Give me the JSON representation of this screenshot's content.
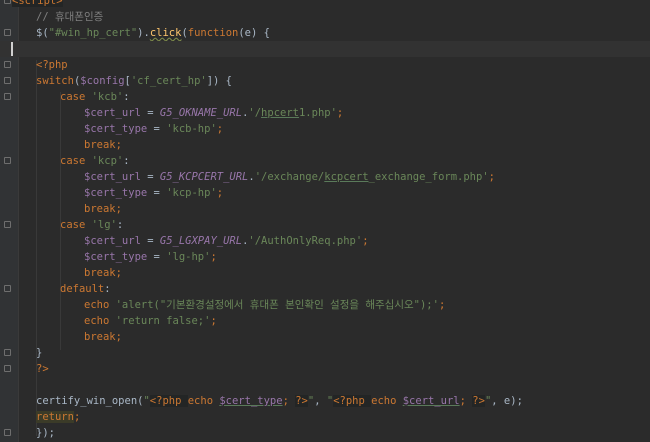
{
  "editor": {
    "theme": {
      "background": "#2b2b2b",
      "keyword": "#cc7832",
      "string": "#6a8759",
      "comment": "#808080",
      "function": "#ffc66d",
      "variable": "#9876aa",
      "text": "#a9b7c6"
    },
    "lines": [
      {
        "indent": 0,
        "tokens": [
          {
            "t": "<script>",
            "c": "tag"
          }
        ],
        "fold": true
      },
      {
        "indent": 1,
        "tokens": [
          {
            "t": "// 휴대폰인증",
            "c": "c"
          }
        ]
      },
      {
        "indent": 1,
        "tokens": [
          {
            "t": "$(",
            "c": "p"
          },
          {
            "t": "\"#win_hp_cert\"",
            "c": "s"
          },
          {
            "t": ").",
            "c": "p"
          },
          {
            "t": "click",
            "c": "f w"
          },
          {
            "t": "(",
            "c": "p"
          },
          {
            "t": "function",
            "c": "k"
          },
          {
            "t": "(e) {",
            "c": "p"
          }
        ],
        "fold": true
      },
      {
        "indent": 0,
        "tokens": [],
        "highlight": true,
        "caret": true
      },
      {
        "indent": 1,
        "tokens": [
          {
            "t": "<?php",
            "c": "k"
          }
        ],
        "fold": true
      },
      {
        "indent": 1,
        "tokens": [
          {
            "t": "switch",
            "c": "k"
          },
          {
            "t": "(",
            "c": "p"
          },
          {
            "t": "$config",
            "c": "v"
          },
          {
            "t": "[",
            "c": "p"
          },
          {
            "t": "'cf_cert_hp'",
            "c": "s"
          },
          {
            "t": "]) {",
            "c": "p"
          }
        ],
        "fold": true
      },
      {
        "indent": 2,
        "tokens": [
          {
            "t": "case ",
            "c": "k"
          },
          {
            "t": "'kcb'",
            "c": "s"
          },
          {
            "t": ":",
            "c": "p"
          }
        ],
        "fold": true
      },
      {
        "indent": 3,
        "tokens": [
          {
            "t": "$cert_url",
            "c": "v"
          },
          {
            "t": " = ",
            "c": "p"
          },
          {
            "t": "G5_OKNAME_URL",
            "c": "kc"
          },
          {
            "t": ".",
            "c": "p"
          },
          {
            "t": "'/",
            "c": "s"
          },
          {
            "t": "hpcert",
            "c": "s u"
          },
          {
            "t": "1.php'",
            "c": "s"
          },
          {
            "t": ";",
            "c": "k"
          }
        ]
      },
      {
        "indent": 3,
        "tokens": [
          {
            "t": "$cert_type",
            "c": "v"
          },
          {
            "t": " = ",
            "c": "p"
          },
          {
            "t": "'kcb-hp'",
            "c": "s"
          },
          {
            "t": ";",
            "c": "k"
          }
        ]
      },
      {
        "indent": 3,
        "tokens": [
          {
            "t": "break",
            "c": "k"
          },
          {
            "t": ";",
            "c": "k"
          }
        ]
      },
      {
        "indent": 2,
        "tokens": [
          {
            "t": "case ",
            "c": "k"
          },
          {
            "t": "'kcp'",
            "c": "s"
          },
          {
            "t": ":",
            "c": "p"
          }
        ],
        "fold": true
      },
      {
        "indent": 3,
        "tokens": [
          {
            "t": "$cert_url",
            "c": "v"
          },
          {
            "t": " = ",
            "c": "p"
          },
          {
            "t": "G5_KCPCERT_URL",
            "c": "kc"
          },
          {
            "t": ".",
            "c": "p"
          },
          {
            "t": "'/exchange/",
            "c": "s"
          },
          {
            "t": "kcpcert",
            "c": "s u"
          },
          {
            "t": "_exchange_form.php'",
            "c": "s"
          },
          {
            "t": ";",
            "c": "k"
          }
        ]
      },
      {
        "indent": 3,
        "tokens": [
          {
            "t": "$cert_type",
            "c": "v"
          },
          {
            "t": " = ",
            "c": "p"
          },
          {
            "t": "'kcp-hp'",
            "c": "s"
          },
          {
            "t": ";",
            "c": "k"
          }
        ]
      },
      {
        "indent": 3,
        "tokens": [
          {
            "t": "break",
            "c": "k"
          },
          {
            "t": ";",
            "c": "k"
          }
        ]
      },
      {
        "indent": 2,
        "tokens": [
          {
            "t": "case ",
            "c": "k"
          },
          {
            "t": "'lg'",
            "c": "s"
          },
          {
            "t": ":",
            "c": "p"
          }
        ],
        "fold": true
      },
      {
        "indent": 3,
        "tokens": [
          {
            "t": "$cert_url",
            "c": "v"
          },
          {
            "t": " = ",
            "c": "p"
          },
          {
            "t": "G5_LGXPAY_URL",
            "c": "kc"
          },
          {
            "t": ".",
            "c": "p"
          },
          {
            "t": "'/AuthOnlyReq.php'",
            "c": "s"
          },
          {
            "t": ";",
            "c": "k"
          }
        ]
      },
      {
        "indent": 3,
        "tokens": [
          {
            "t": "$cert_type",
            "c": "v"
          },
          {
            "t": " = ",
            "c": "p"
          },
          {
            "t": "'lg-hp'",
            "c": "s"
          },
          {
            "t": ";",
            "c": "k"
          }
        ]
      },
      {
        "indent": 3,
        "tokens": [
          {
            "t": "break",
            "c": "k"
          },
          {
            "t": ";",
            "c": "k"
          }
        ]
      },
      {
        "indent": 2,
        "tokens": [
          {
            "t": "default",
            "c": "k"
          },
          {
            "t": ":",
            "c": "p"
          }
        ],
        "fold": true
      },
      {
        "indent": 3,
        "tokens": [
          {
            "t": "echo ",
            "c": "k"
          },
          {
            "t": "'alert(\"기본환경설정에서 휴대폰 본인확인 설정을 해주십시오\");'",
            "c": "s"
          },
          {
            "t": ";",
            "c": "k"
          }
        ]
      },
      {
        "indent": 3,
        "tokens": [
          {
            "t": "echo ",
            "c": "k"
          },
          {
            "t": "'return false;'",
            "c": "s"
          },
          {
            "t": ";",
            "c": "k"
          }
        ]
      },
      {
        "indent": 3,
        "tokens": [
          {
            "t": "break",
            "c": "k"
          },
          {
            "t": ";",
            "c": "k"
          }
        ]
      },
      {
        "indent": 1,
        "tokens": [
          {
            "t": "}",
            "c": "p"
          }
        ],
        "fold": true
      },
      {
        "indent": 1,
        "tokens": [
          {
            "t": "?>",
            "c": "k"
          }
        ],
        "fold": true
      },
      {
        "indent": 0,
        "tokens": []
      },
      {
        "indent": 1,
        "tokens": [
          {
            "t": "certify_win_open(",
            "c": "p"
          },
          {
            "t": "\"",
            "c": "s"
          },
          {
            "t": "<?php ",
            "c": "tag"
          },
          {
            "t": "echo ",
            "c": "k"
          },
          {
            "t": "$cert_type",
            "c": "v u"
          },
          {
            "t": "; ",
            "c": "k"
          },
          {
            "t": "?>",
            "c": "tag"
          },
          {
            "t": "\"",
            "c": "s"
          },
          {
            "t": ", ",
            "c": "p"
          },
          {
            "t": "\"",
            "c": "s"
          },
          {
            "t": "<?php ",
            "c": "tag"
          },
          {
            "t": "echo ",
            "c": "k"
          },
          {
            "t": "$cert_url",
            "c": "v u"
          },
          {
            "t": "; ",
            "c": "k"
          },
          {
            "t": "?>",
            "c": "tag"
          },
          {
            "t": "\"",
            "c": "s"
          },
          {
            "t": ", e);",
            "c": "p"
          }
        ]
      },
      {
        "indent": 1,
        "tokens": [
          {
            "t": "return",
            "c": "rk"
          },
          {
            "t": ";",
            "c": "k"
          }
        ]
      },
      {
        "indent": 1,
        "tokens": [
          {
            "t": "});",
            "c": "p"
          }
        ],
        "fold": true
      }
    ]
  }
}
